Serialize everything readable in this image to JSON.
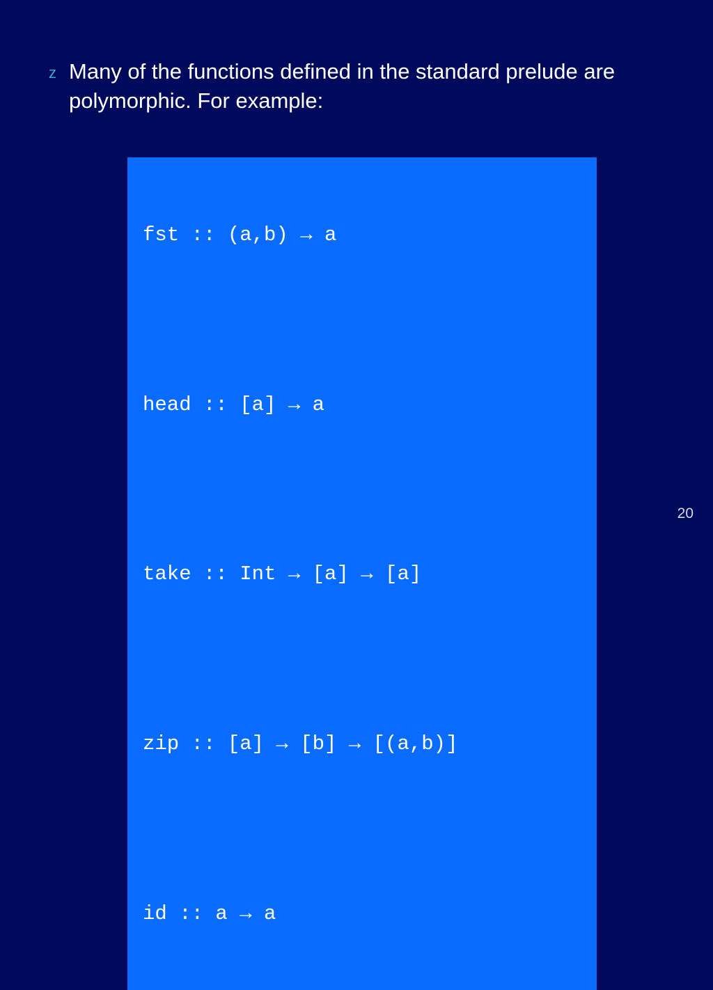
{
  "bullet_glyph": "z",
  "body_text": "Many of the functions defined in the standard prelude are polymorphic.  For example:",
  "code": {
    "l1": "fst :: (a,b) → a",
    "l2": "head :: [a] → a",
    "l3": "take :: Int → [a] → [a]",
    "l4": "zip :: [a] → [b] → [(a,b)]",
    "l5": "id :: a → a"
  },
  "page_number": "20"
}
